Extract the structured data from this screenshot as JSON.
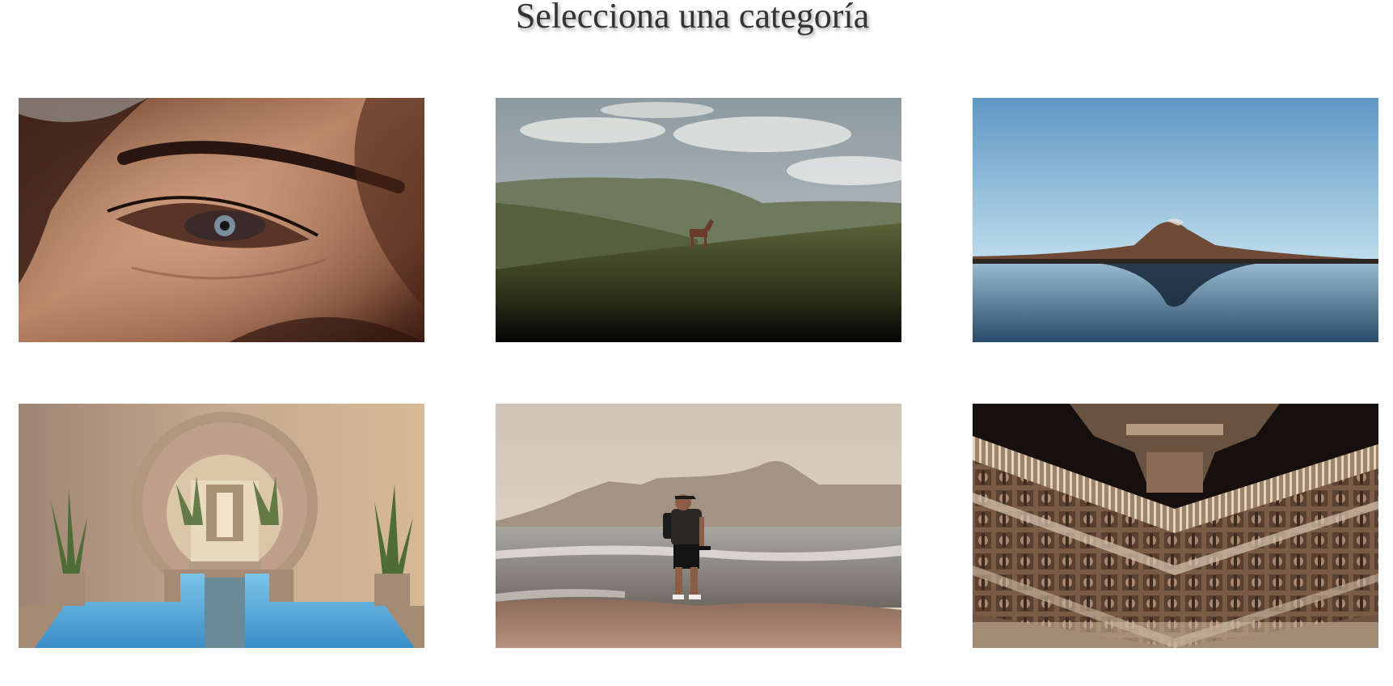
{
  "page": {
    "title": "Selecciona una categoría"
  },
  "categories": [
    {
      "id": "portrait",
      "icon": "eye-closeup-photo"
    },
    {
      "id": "animals",
      "icon": "horse-on-hill-photo"
    },
    {
      "id": "landscape",
      "icon": "mountain-reflection-photo"
    },
    {
      "id": "architecture",
      "icon": "arched-pool-photo"
    },
    {
      "id": "travel",
      "icon": "hiker-at-sea-photo"
    },
    {
      "id": "heritage",
      "icon": "carved-temple-photo"
    }
  ]
}
